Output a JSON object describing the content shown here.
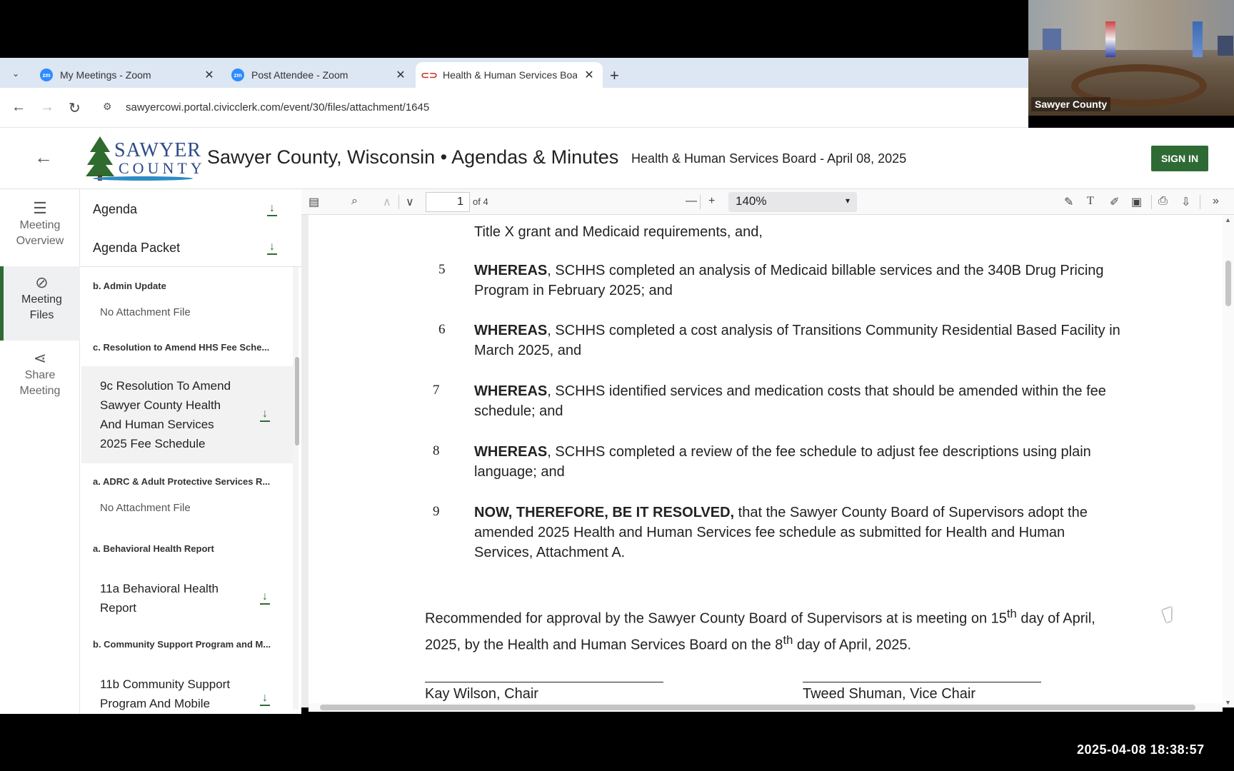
{
  "browser": {
    "tabs": [
      {
        "label": "My Meetings - Zoom",
        "favicon": "zoom-icon"
      },
      {
        "label": "Post Attendee - Zoom",
        "favicon": "zoom-icon"
      },
      {
        "label": "Health & Human Services Boar",
        "favicon": "civicclerk-icon"
      }
    ],
    "url": "sawyercowi.portal.civicclerk.com/event/30/files/attachment/1645",
    "favicon_text": "zm"
  },
  "video": {
    "label": "Sawyer County"
  },
  "header": {
    "logo_line1": "SAWYER",
    "logo_line2": "COUNTY",
    "site_title": "Sawyer County, Wisconsin • Agendas & Minutes",
    "meeting_title": "Health & Human Services Board - April 08, 2025",
    "signin_label": "SIGN IN"
  },
  "rail": {
    "items": [
      {
        "label_1": "Meeting",
        "label_2": "Overview"
      },
      {
        "label_1": "Meeting",
        "label_2": "Files"
      },
      {
        "label_1": "Share",
        "label_2": "Meeting"
      }
    ]
  },
  "files": {
    "agenda": "Agenda",
    "agenda_packet": "Agenda Packet",
    "sections": [
      {
        "title": "b. Admin Update",
        "no_attachment": "No Attachment File"
      },
      {
        "title": "c. Resolution to Amend HHS Fee Sche..."
      },
      {
        "title": "a. ADRC & Adult Protective Services R...",
        "no_attachment": "No Attachment File"
      },
      {
        "title": "a. Behavioral Health Report"
      },
      {
        "title": "b. Community Support Program and M..."
      }
    ],
    "file_9c": [
      "9c Resolution To Amend",
      "Sawyer County Health",
      "And Human Services",
      "2025 Fee Schedule"
    ],
    "file_11a": [
      "11a Behavioral Health",
      "Report"
    ],
    "file_11b": [
      "11b Community Support",
      "Program And Mobile"
    ]
  },
  "pdf_toolbar": {
    "page_current": "1",
    "page_of": "of 4",
    "zoom": "140%"
  },
  "document": {
    "top_line": "Title X grant and Medicaid requirements, and,",
    "lines": [
      {
        "num": "5",
        "bold": "WHEREAS",
        "text": ", SCHHS completed an analysis of Medicaid billable services and the 340B Drug Pricing Program in February 2025; and"
      },
      {
        "num": "6",
        "bold": "WHEREAS",
        "text": ", SCHHS completed a cost analysis of Transitions Community Residential Based Facility in March 2025, and"
      },
      {
        "num": "7",
        "bold": "WHEREAS",
        "text": ", SCHHS identified services and medication costs that should be amended within the fee schedule; and"
      },
      {
        "num": "8",
        "bold": "WHEREAS",
        "text": ", SCHHS completed a review of the fee schedule to adjust fee descriptions using plain language; and"
      },
      {
        "num": "9",
        "bold": "NOW, THEREFORE, BE IT RESOLVED,",
        "text": " that the Sawyer County Board of Supervisors adopt the amended 2025 Health and Human Services fee schedule as submitted for Health and Human Services, Attachment  A."
      }
    ],
    "recommendation_1": "Recommended for approval by the Sawyer County Board of Supervisors at is meeting on 15",
    "rec_sup_1": "th",
    "recommendation_2": " day of April, 2025, by the Health and Human Services Board on the 8",
    "rec_sup_2": "th",
    "recommendation_3": " day of April, 2025.",
    "signer_1": "Kay Wilson, Chair",
    "signer_2": "Tweed Shuman, Vice Chair"
  },
  "timestamp": "2025-04-08 18:38:57",
  "colors": {
    "accent_green": "#2e6b34",
    "logo_blue": "#2d4a8a"
  }
}
